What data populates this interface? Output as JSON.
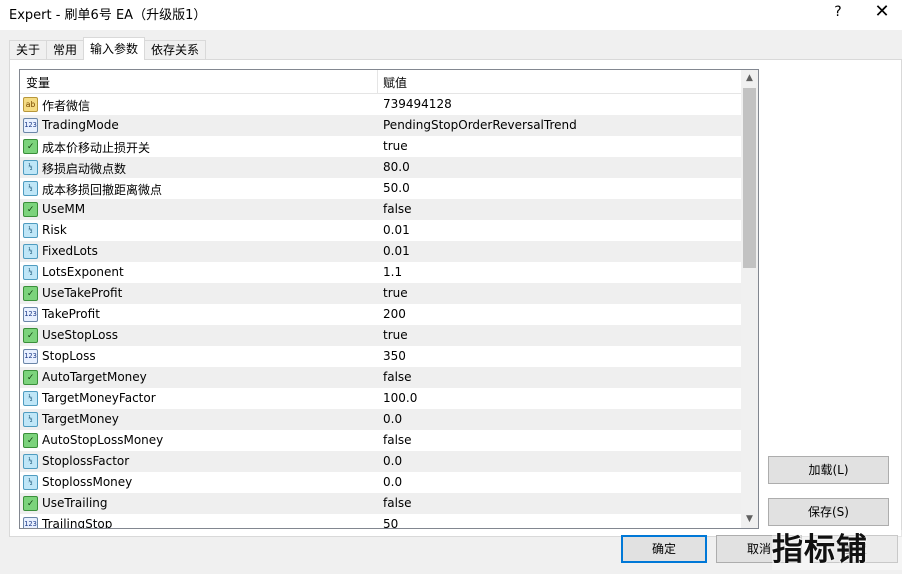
{
  "window": {
    "title": "Expert - 刷单6号 EA（升级版1）",
    "help_label": "?",
    "close_label": "✕"
  },
  "tabs": [
    {
      "label": "关于",
      "active": false
    },
    {
      "label": "常用",
      "active": false
    },
    {
      "label": "输入参数",
      "active": true
    },
    {
      "label": "依存关系",
      "active": false
    }
  ],
  "grid": {
    "col_variable": "变量",
    "col_value": "赋值",
    "rows": [
      {
        "icon": "string-type-icon",
        "icon_text": "ab",
        "kind": "string",
        "name": "作者微信",
        "value": "739494128"
      },
      {
        "icon": "int-type-icon",
        "icon_text": "123",
        "kind": "int",
        "name": "TradingMode",
        "value": "PendingStopOrderReversalTrend"
      },
      {
        "icon": "bool-type-icon",
        "icon_text": "✓",
        "kind": "bool",
        "name": "成本价移动止损开关",
        "value": "true"
      },
      {
        "icon": "double-type-icon",
        "icon_text": "½",
        "kind": "dbl",
        "name": "移损启动微点数",
        "value": "80.0"
      },
      {
        "icon": "double-type-icon",
        "icon_text": "½",
        "kind": "dbl",
        "name": "成本移损回撤距离微点",
        "value": "50.0"
      },
      {
        "icon": "bool-type-icon",
        "icon_text": "✓",
        "kind": "bool",
        "name": "UseMM",
        "value": "false"
      },
      {
        "icon": "double-type-icon",
        "icon_text": "½",
        "kind": "dbl",
        "name": "Risk",
        "value": "0.01"
      },
      {
        "icon": "double-type-icon",
        "icon_text": "½",
        "kind": "dbl",
        "name": "FixedLots",
        "value": "0.01"
      },
      {
        "icon": "double-type-icon",
        "icon_text": "½",
        "kind": "dbl",
        "name": "LotsExponent",
        "value": "1.1"
      },
      {
        "icon": "bool-type-icon",
        "icon_text": "✓",
        "kind": "bool",
        "name": "UseTakeProfit",
        "value": "true"
      },
      {
        "icon": "int-type-icon",
        "icon_text": "123",
        "kind": "int",
        "name": "TakeProfit",
        "value": "200"
      },
      {
        "icon": "bool-type-icon",
        "icon_text": "✓",
        "kind": "bool",
        "name": "UseStopLoss",
        "value": "true"
      },
      {
        "icon": "int-type-icon",
        "icon_text": "123",
        "kind": "int",
        "name": "StopLoss",
        "value": "350"
      },
      {
        "icon": "bool-type-icon",
        "icon_text": "✓",
        "kind": "bool",
        "name": "AutoTargetMoney",
        "value": "false"
      },
      {
        "icon": "double-type-icon",
        "icon_text": "½",
        "kind": "dbl",
        "name": "TargetMoneyFactor",
        "value": "100.0"
      },
      {
        "icon": "double-type-icon",
        "icon_text": "½",
        "kind": "dbl",
        "name": "TargetMoney",
        "value": "0.0"
      },
      {
        "icon": "bool-type-icon",
        "icon_text": "✓",
        "kind": "bool",
        "name": "AutoStopLossMoney",
        "value": "false"
      },
      {
        "icon": "double-type-icon",
        "icon_text": "½",
        "kind": "dbl",
        "name": "StoplossFactor",
        "value": "0.0"
      },
      {
        "icon": "double-type-icon",
        "icon_text": "½",
        "kind": "dbl",
        "name": "StoplossMoney",
        "value": "0.0"
      },
      {
        "icon": "bool-type-icon",
        "icon_text": "✓",
        "kind": "bool",
        "name": "UseTrailing",
        "value": "false"
      },
      {
        "icon": "int-type-icon",
        "icon_text": "123",
        "kind": "int",
        "name": "TrailingStop",
        "value": "50"
      }
    ]
  },
  "buttons": {
    "load": "加载(L)",
    "save": "保存(S)",
    "ok": "确定",
    "cancel": "取消",
    "reset": "重置"
  },
  "watermark": "指标铺"
}
